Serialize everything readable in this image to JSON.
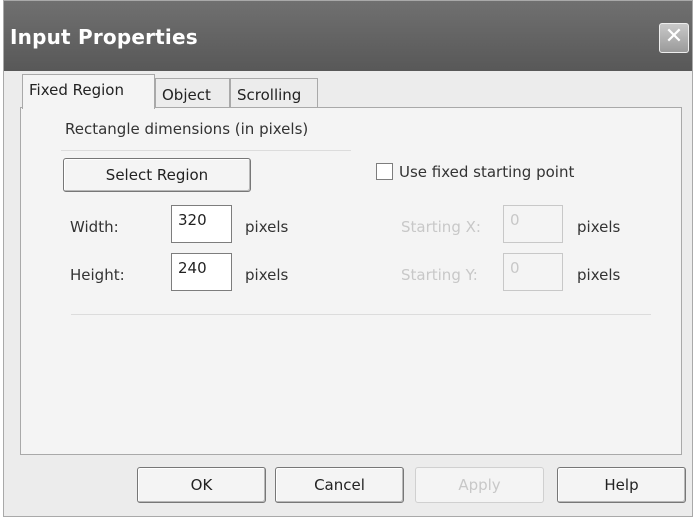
{
  "dialog": {
    "title": "Input Properties",
    "close_glyph": "✕"
  },
  "tabs": [
    {
      "label": "Fixed Region",
      "active": true
    },
    {
      "label": "Object",
      "active": false
    },
    {
      "label": "Scrolling",
      "active": false
    }
  ],
  "region": {
    "group_label": "Rectangle dimensions (in pixels)",
    "select_button": "Select Region",
    "width_label": "Width:",
    "width_value": "320",
    "height_label": "Height:",
    "height_value": "240",
    "units": "pixels",
    "use_fixed_label": "Use fixed starting point",
    "use_fixed_checked": false,
    "start_x_label": "Starting X:",
    "start_x_value": "0",
    "start_y_label": "Starting Y:",
    "start_y_value": "0"
  },
  "footer": {
    "ok": "OK",
    "cancel": "Cancel",
    "apply": "Apply",
    "help": "Help"
  },
  "icons": {
    "close": "close-icon"
  }
}
